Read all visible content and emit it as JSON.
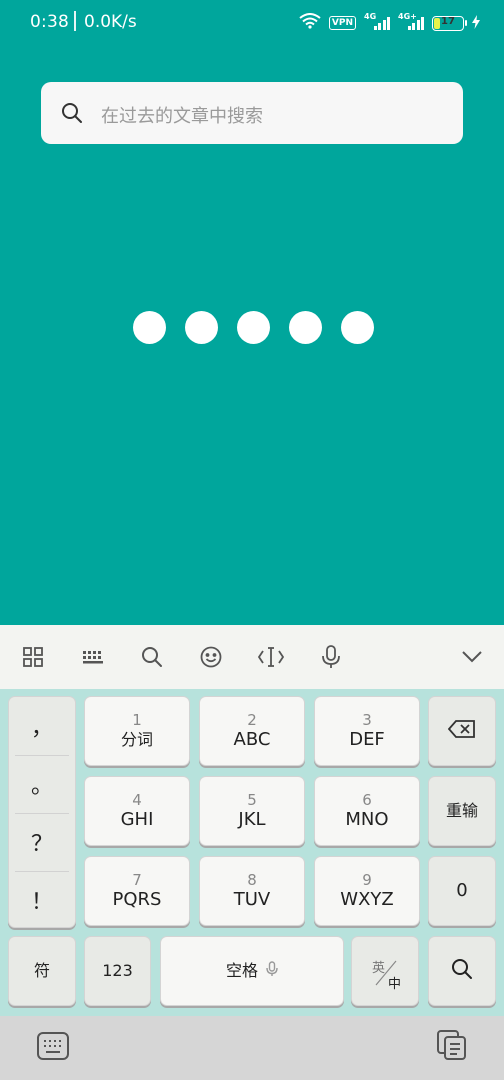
{
  "status_bar": {
    "time": "0:38",
    "speed": "0.0K/s",
    "vpn": "VPN",
    "net1": "4G",
    "net2": "4G+",
    "battery": "17"
  },
  "search": {
    "placeholder": "在过去的文章中搜索"
  },
  "loading": {
    "dot_count": 5
  },
  "keyboard": {
    "toolbar_icons": [
      "grid-icon",
      "keyboard-icon",
      "search-icon",
      "emoji-icon",
      "cursor-icon",
      "mic-icon",
      "chevron-down-icon"
    ],
    "symbols": [
      "，",
      "。",
      "？",
      "！"
    ],
    "keys": {
      "k1": {
        "num": "1",
        "label": "分词"
      },
      "k2": {
        "num": "2",
        "label": "ABC"
      },
      "k3": {
        "num": "3",
        "label": "DEF"
      },
      "k4": {
        "num": "4",
        "label": "GHI"
      },
      "k5": {
        "num": "5",
        "label": "JKL"
      },
      "k6": {
        "num": "6",
        "label": "MNO"
      },
      "k7": {
        "num": "7",
        "label": "PQRS"
      },
      "k8": {
        "num": "8",
        "label": "TUV"
      },
      "k9": {
        "num": "9",
        "label": "WXYZ"
      }
    },
    "reenter": "重输",
    "zero": "0",
    "fu": "符",
    "num_switch": "123",
    "space": "空格",
    "lang_top": "英",
    "lang_bottom": "中"
  },
  "colors": {
    "accent": "#00a69c",
    "keyboard_bg": "#b7e2dc"
  }
}
